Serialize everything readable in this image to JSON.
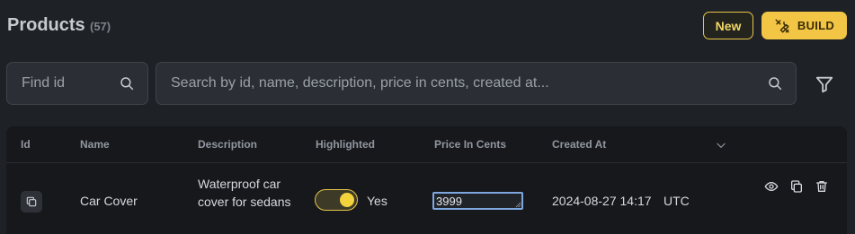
{
  "header": {
    "title": "Products",
    "count": "(57)",
    "new_label": "New",
    "build_label": "BUILD"
  },
  "search": {
    "find_id_placeholder": "Find id",
    "main_placeholder": "Search by id, name, description, price in cents, created at..."
  },
  "table": {
    "columns": [
      "Id",
      "Name",
      "Description",
      "Highlighted",
      "Price In Cents",
      "Created At"
    ],
    "rows": [
      {
        "name": "Car Cover",
        "description": "Waterproof car cover for sedans",
        "highlighted": true,
        "highlighted_label": "Yes",
        "price_in_cents": "3999",
        "created_at": "2024-08-27 14:17",
        "timezone": "UTC"
      }
    ]
  },
  "icons": {
    "find_id": "search-icon",
    "main_search": "search-icon",
    "filter": "filter-icon",
    "build": "tools-icon",
    "sort": "chevron-down-icon",
    "row_id": "copy-id-icon",
    "row_actions": [
      "eye-icon",
      "duplicate-icon",
      "trash-icon"
    ]
  },
  "colors": {
    "background": "#1e2125",
    "table_background": "#16181b",
    "accent": "#f3c545",
    "focus": "#7ea7e0"
  }
}
